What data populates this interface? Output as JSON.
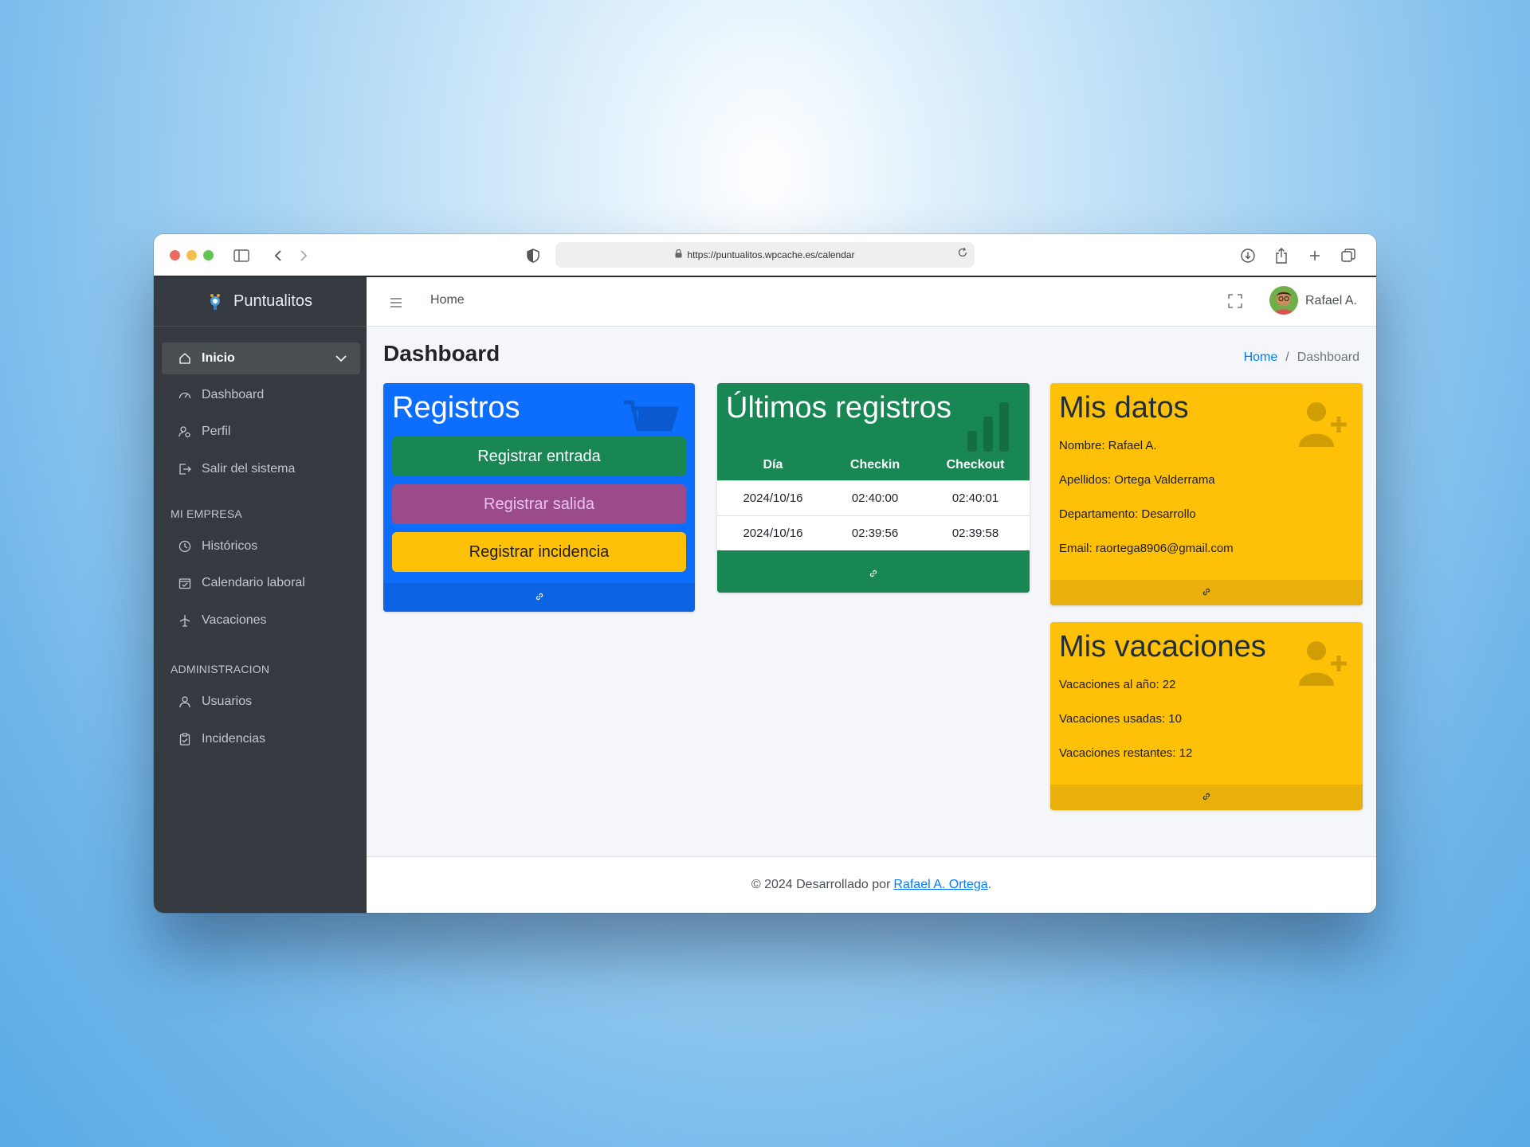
{
  "browser": {
    "url": "https://puntualitos.wpcache.es/calendar"
  },
  "sidebar": {
    "brand": "Puntualitos",
    "items": [
      {
        "label": "Inicio",
        "icon": "home-icon"
      },
      {
        "label": "Dashboard",
        "icon": "dashboard-icon"
      },
      {
        "label": "Perfil",
        "icon": "user-gear-icon"
      },
      {
        "label": "Salir del sistema",
        "icon": "logout-icon"
      }
    ],
    "section_empresa": "MI EMPRESA",
    "empresa_items": [
      {
        "label": "Históricos",
        "icon": "clock-icon"
      },
      {
        "label": "Calendario laboral",
        "icon": "calendar-icon"
      },
      {
        "label": "Vacaciones",
        "icon": "plane-icon"
      }
    ],
    "section_admin": "ADMINISTRACION",
    "admin_items": [
      {
        "label": "Usuarios",
        "icon": "user-icon"
      },
      {
        "label": "Incidencias",
        "icon": "clipboard-icon"
      }
    ]
  },
  "topnav": {
    "home": "Home",
    "user": "Rafael A."
  },
  "page": {
    "title": "Dashboard",
    "breadcrumb": [
      "Home",
      "/",
      "Dashboard"
    ]
  },
  "registros": {
    "title": "Registros",
    "btn_entrada": "Registrar entrada",
    "btn_salida": "Registrar salida",
    "btn_incidencia": "Registrar incidencia"
  },
  "ultimos": {
    "title": "Últimos registros",
    "columns": [
      "Día",
      "Checkin",
      "Checkout"
    ],
    "rows": [
      [
        "2024/10/16",
        "02:40:00",
        "02:40:01"
      ],
      [
        "2024/10/16",
        "02:39:56",
        "02:39:58"
      ]
    ]
  },
  "datos": {
    "title": "Mis datos",
    "nombre": "Nombre: Rafael A.",
    "apellidos": "Apellidos: Ortega Valderrama",
    "departamento": "Departamento: Desarrollo",
    "email": "Email: raortega8906@gmail.com"
  },
  "vacaciones": {
    "title": "Mis vacaciones",
    "anio": "Vacaciones al año: 22",
    "usadas": "Vacaciones usadas: 10",
    "restantes": "Vacaciones restantes: 12"
  },
  "footer": {
    "text": "© 2024 Desarrollado por",
    "author": "Rafael A. Ortega",
    "suffix": "."
  },
  "colors": {
    "sidebar": "#343a40",
    "primary": "#0d6efd",
    "success": "#198754",
    "warning": "#ffc107",
    "purple": "#9b4a8a"
  }
}
